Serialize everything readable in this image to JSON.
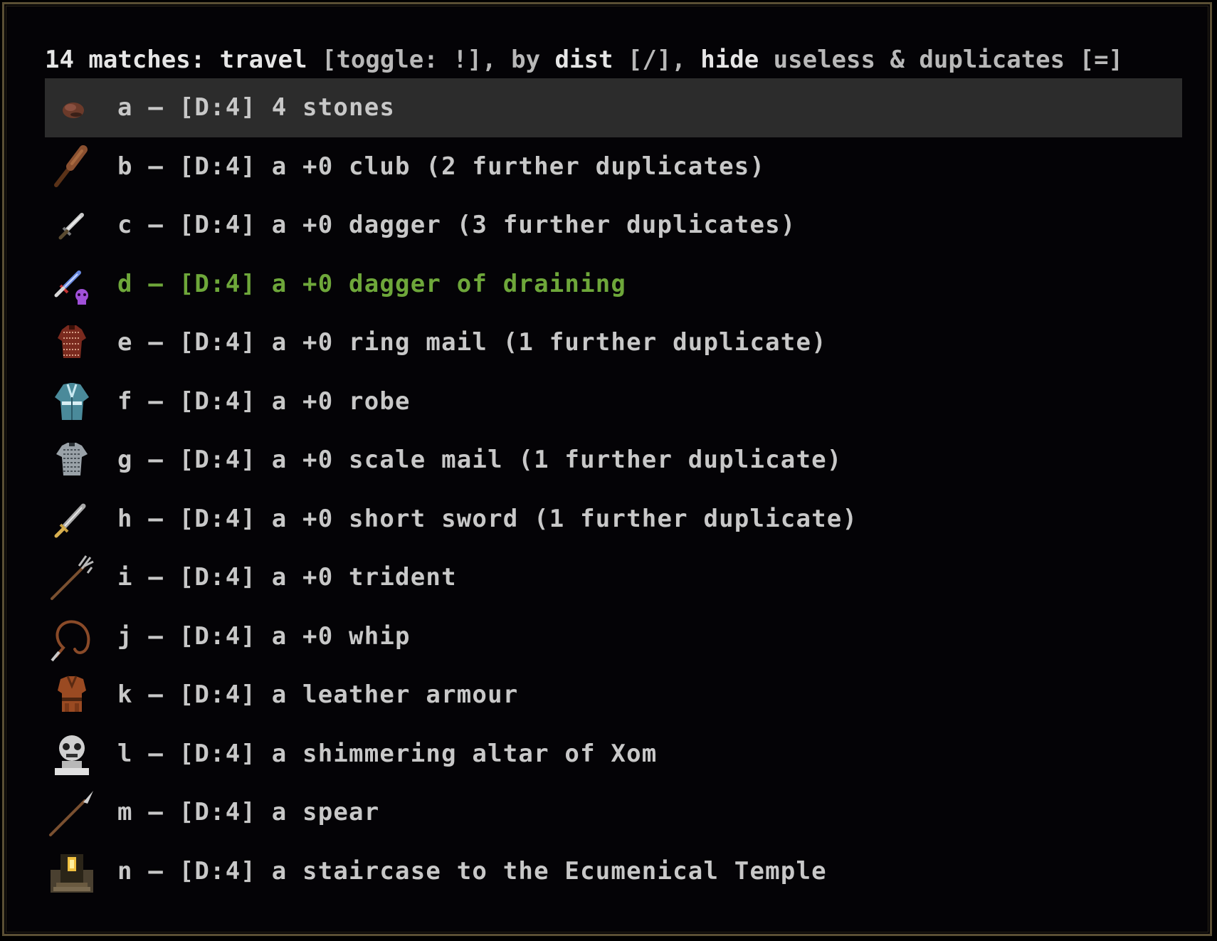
{
  "header": {
    "count": "14 matches:",
    "travel": "travel",
    "toggle": "[toggle: !],",
    "by": "by",
    "dist": "dist",
    "dist_key": "[/],",
    "hide": "hide",
    "useless": "useless",
    "amp": "&",
    "duplicates": "duplicates",
    "dup_key": "[=]"
  },
  "items": [
    {
      "text": "a – [D:4] 4 stones",
      "icon": "stone-icon"
    },
    {
      "text": "b – [D:4] a +0 club (2 further duplicates)",
      "icon": "club-icon"
    },
    {
      "text": "c – [D:4] a +0 dagger (3 further duplicates)",
      "icon": "dagger-icon"
    },
    {
      "text": "d – [D:4] a +0 dagger of draining",
      "icon": "dagger-draining-icon"
    },
    {
      "text": "e – [D:4] a +0 ring mail (1 further duplicate)",
      "icon": "ring-mail-icon"
    },
    {
      "text": "f – [D:4] a +0 robe",
      "icon": "robe-icon"
    },
    {
      "text": "g – [D:4] a +0 scale mail (1 further duplicate)",
      "icon": "scale-mail-icon"
    },
    {
      "text": "h – [D:4] a +0 short sword (1 further duplicate)",
      "icon": "short-sword-icon"
    },
    {
      "text": "i – [D:4] a +0 trident",
      "icon": "trident-icon"
    },
    {
      "text": "j – [D:4] a +0 whip",
      "icon": "whip-icon"
    },
    {
      "text": "k – [D:4] a leather armour",
      "icon": "leather-armour-icon"
    },
    {
      "text": "l – [D:4] a shimmering altar of Xom",
      "icon": "altar-xom-icon"
    },
    {
      "text": "m – [D:4] a spear",
      "icon": "spear-icon"
    },
    {
      "text": "n – [D:4] a staircase to the Ecumenical Temple",
      "icon": "temple-staircase-icon"
    }
  ],
  "colors": {
    "text": "#c8c8c8",
    "highlight_row": "#2c2c2c",
    "artefact_green": "#6ea73a",
    "border": "#5a4f34"
  }
}
